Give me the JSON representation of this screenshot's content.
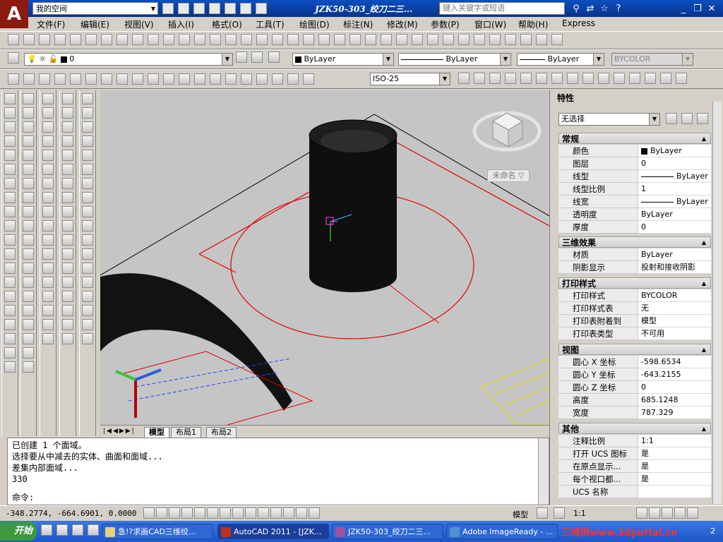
{
  "titlebar": {
    "workspace": "我的空间",
    "doc_title": "JZK50-303_绞刀二三...",
    "search_placeholder": "键入关键字或短语"
  },
  "menu": [
    "文件(F)",
    "编辑(E)",
    "视图(V)",
    "插入(I)",
    "格式(O)",
    "工具(T)",
    "绘图(D)",
    "标注(N)",
    "修改(M)",
    "参数(P)",
    "窗口(W)",
    "帮助(H)",
    "Express"
  ],
  "layer_bar": {
    "layer_value": "0",
    "color": "ByLayer",
    "linetype": "ByLayer",
    "lineweight": "ByLayer",
    "plotstyle": "BYCOLOR"
  },
  "dim_bar": {
    "dimstyle": "ISO-25"
  },
  "viewport": {
    "viewcube_label": "未命名",
    "tabs": [
      "模型",
      "布局1",
      "布局2"
    ]
  },
  "properties": {
    "title": "特性",
    "selection": "无选择",
    "sections": [
      {
        "name": "常规",
        "rows": [
          [
            "颜色",
            "ByLayer"
          ],
          [
            "图层",
            "0"
          ],
          [
            "线型",
            "ByLayer"
          ],
          [
            "线型比例",
            "1"
          ],
          [
            "线宽",
            "ByLayer"
          ],
          [
            "透明度",
            "ByLayer"
          ],
          [
            "厚度",
            "0"
          ]
        ]
      },
      {
        "name": "三维效果",
        "rows": [
          [
            "材质",
            "ByLayer"
          ],
          [
            "阴影显示",
            "投射和接收阴影"
          ]
        ]
      },
      {
        "name": "打印样式",
        "rows": [
          [
            "打印样式",
            "BYCOLOR"
          ],
          [
            "打印样式表",
            "无"
          ],
          [
            "打印表附着到",
            "模型"
          ],
          [
            "打印表类型",
            "不可用"
          ]
        ]
      },
      {
        "name": "视图",
        "rows": [
          [
            "圆心 X 坐标",
            "-598.6534"
          ],
          [
            "圆心 Y 坐标",
            "-643.2155"
          ],
          [
            "圆心 Z 坐标",
            "0"
          ],
          [
            "高度",
            "685.1248"
          ],
          [
            "宽度",
            "787.329"
          ]
        ]
      },
      {
        "name": "其他",
        "rows": [
          [
            "注释比例",
            "1:1"
          ],
          [
            "打开 UCS 图标",
            "是"
          ],
          [
            "在原点显示...",
            "是"
          ],
          [
            "每个视口都...",
            "是"
          ],
          [
            "UCS 名称",
            ""
          ]
        ]
      }
    ]
  },
  "command": {
    "history": [
      "已创建 1 个面域。",
      "选择要从中减去的实体、曲面和面域...",
      "差集内部面域...",
      "330"
    ],
    "prompt": "命令:"
  },
  "status": {
    "coords": "-348.2774, -664.6901, 0.0000",
    "space": "模型",
    "scale": "1:1"
  },
  "taskbar": {
    "start": "开始",
    "tasks": [
      "急!?求画CAD三维绞...",
      "AutoCAD 2011 - [JZK...",
      "JZK50-303_绞刀二三...",
      "Adobe ImageReady - ..."
    ],
    "watermark": "三维网www.3dportal.cn",
    "clock_tail": "2"
  },
  "colors": {
    "accent": "#0a4fbf",
    "drawing_red": "#ff0000",
    "viewport_bg": "#c5c5c5"
  }
}
